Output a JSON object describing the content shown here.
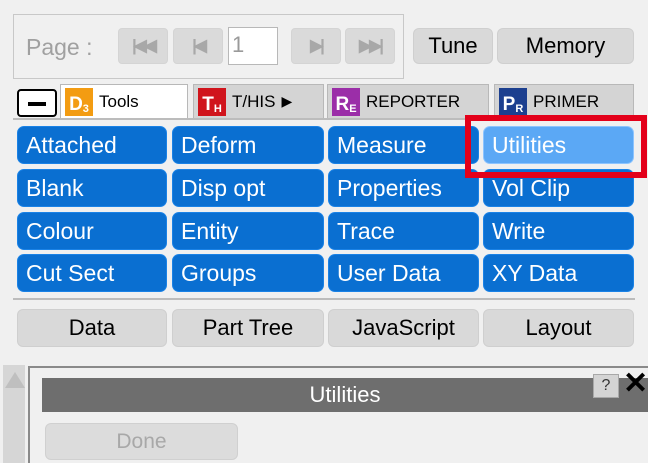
{
  "pager": {
    "label": "Page :",
    "first_icon": "first-page-icon",
    "prev_icon": "prev-page-icon",
    "page_value": "1",
    "next_icon": "next-page-icon",
    "last_icon": "last-page-icon",
    "first_glyph": "|◀◀",
    "prev_glyph": "|◀",
    "next_glyph": "▶|",
    "last_glyph": "▶▶|"
  },
  "toolbar": {
    "tune_label": "Tune",
    "memory_label": "Memory"
  },
  "tabs": [
    {
      "badge": "D",
      "badge_sub": "3",
      "badge_color": "#f39c12",
      "label": "Tools",
      "active": true
    },
    {
      "badge": "T",
      "badge_sub": "H",
      "badge_color": "#d0141c",
      "label": "T/HIS",
      "arrow": "▶",
      "active": false
    },
    {
      "badge": "R",
      "badge_sub": "E",
      "badge_color": "#9b2ea8",
      "label": "REPORTER",
      "active": false
    },
    {
      "badge": "P",
      "badge_sub": "R",
      "badge_color": "#1c3f8f",
      "label": "PRIMER",
      "active": false
    }
  ],
  "tools": {
    "col1": [
      "Attached",
      "Blank",
      "Colour",
      "Cut Sect"
    ],
    "col2": [
      "Deform",
      "Disp opt",
      "Entity",
      "Groups"
    ],
    "col3": [
      "Measure",
      "Properties",
      "Trace",
      "User Data"
    ],
    "col4": [
      "Utilities",
      "Vol Clip",
      "Write",
      "XY Data"
    ],
    "selected": "Utilities"
  },
  "bottom_buttons": [
    "Data",
    "Part Tree",
    "JavaScript",
    "Layout"
  ],
  "utilities_window": {
    "title": "Utilities",
    "help_label": "?",
    "close_label": "✕",
    "done_label": "Done"
  },
  "colors": {
    "tool_button": "#0a6fd1",
    "tool_selected": "#5ba8f5",
    "highlight": "#e3001a"
  }
}
